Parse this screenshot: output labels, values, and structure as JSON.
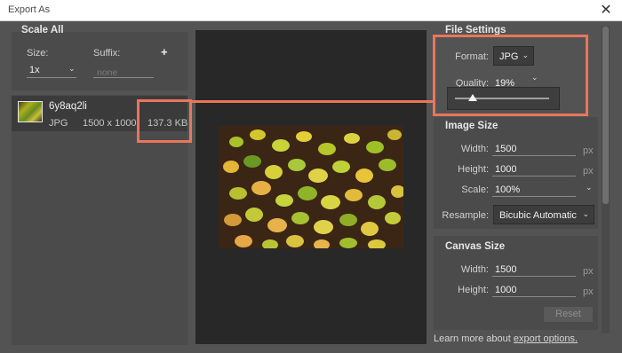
{
  "window": {
    "title": "Export As",
    "close_glyph": "✕"
  },
  "scale_all": {
    "title": "Scale All",
    "size_label": "Size:",
    "size_value": "1x",
    "suffix_label": "Suffix:",
    "suffix_placeholder": "none",
    "add_glyph": "+"
  },
  "asset": {
    "name": "6y8aq2li",
    "format": "JPG",
    "dimensions": "1500 x 1000",
    "file_size": "137.3 KB"
  },
  "file_settings": {
    "title": "File Settings",
    "format_label": "Format:",
    "format_value": "JPG",
    "quality_label": "Quality:",
    "quality_value": "19%",
    "quality_level": 0.19
  },
  "image_size": {
    "title": "Image Size",
    "width_label": "Width:",
    "width_value": "1500",
    "height_label": "Height:",
    "height_value": "1000",
    "scale_label": "Scale:",
    "scale_value": "100%",
    "resample_label": "Resample:",
    "resample_value": "Bicubic Automatic",
    "unit": "px"
  },
  "canvas_size": {
    "title": "Canvas Size",
    "width_label": "Width:",
    "width_value": "1500",
    "height_label": "Height:",
    "height_value": "1000",
    "unit": "px",
    "reset_label": "Reset"
  },
  "footer": {
    "learn_prefix": "Learn more about ",
    "learn_link": "export options."
  },
  "colors": {
    "highlight": "#e9765b",
    "panel": "#4b4b4b",
    "background": "#535353",
    "preview_bg": "#282828"
  }
}
